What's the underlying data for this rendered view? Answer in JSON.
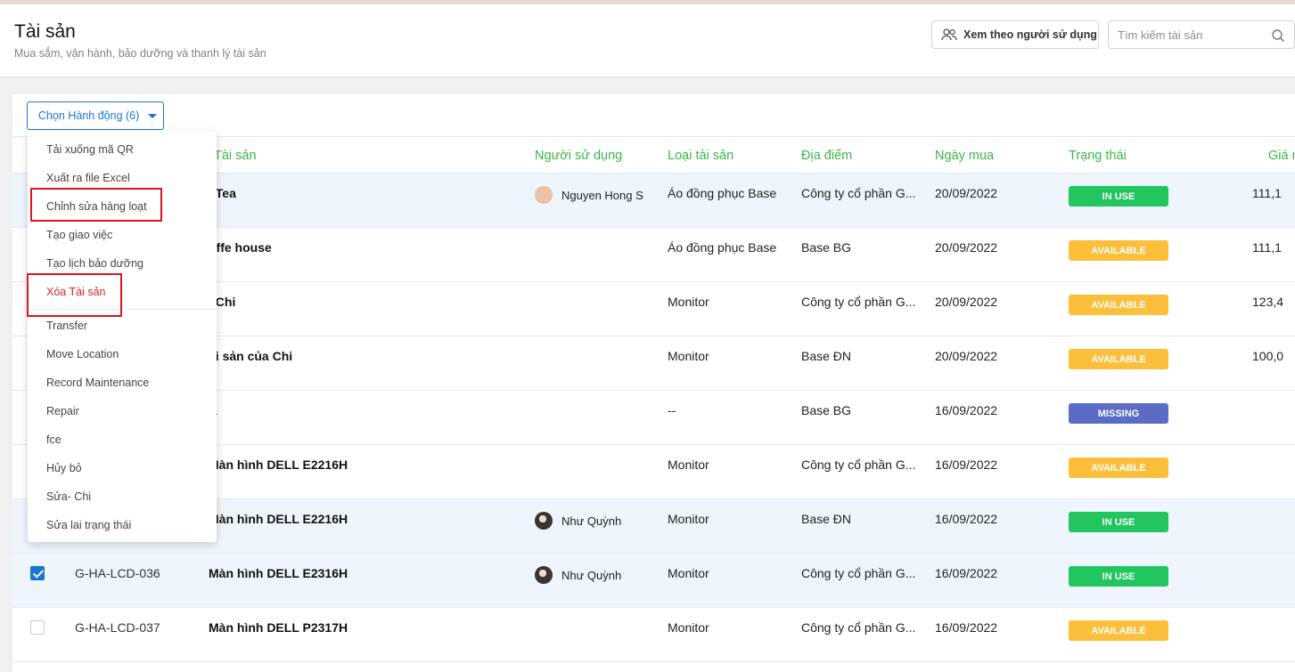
{
  "header": {
    "title": "Tài sản",
    "subtitle": "Mua sắm, vận hành, bảo dưỡng và thanh lý tài sản",
    "view_by_user_label": "Xem theo người sử dụng",
    "search_placeholder": "Tìm kiếm tài sản"
  },
  "toolbar": {
    "action_label": "Chọn Hành động (6)"
  },
  "table": {
    "columns": [
      "Tài sản",
      "Người sử dụng",
      "Loại tài sản",
      "Địa điểm",
      "Ngày mua",
      "Trạng thái",
      "Giá m"
    ],
    "rows": [
      {
        "code": "",
        "name": "i Tea",
        "user": "Nguyen Hong S",
        "avatar": "person",
        "type": "Áo đồng phục Base",
        "location": "Công ty cổ phần G...",
        "date": "20/09/2022",
        "status": "IN USE",
        "price": "111,1",
        "selected": true
      },
      {
        "code": "",
        "name": "offe house",
        "user": "",
        "avatar": "",
        "type": "Áo đồng phục Base",
        "location": "Base BG",
        "date": "20/09/2022",
        "status": "AVAILABLE",
        "price": "111,1",
        "selected": false
      },
      {
        "code": "",
        "name": "i Chi",
        "user": "",
        "avatar": "",
        "type": "Monitor",
        "location": "Công ty cổ phần G...",
        "date": "20/09/2022",
        "status": "AVAILABLE",
        "price": "123,4",
        "selected": false
      },
      {
        "code": "",
        "name": "ài sản của Chi",
        "user": "",
        "avatar": "",
        "type": "Monitor",
        "location": "Base ĐN",
        "date": "20/09/2022",
        "status": "AVAILABLE",
        "price": "100,0",
        "selected": false
      },
      {
        "code": "",
        "name": "A",
        "user": "",
        "avatar": "",
        "type": "--",
        "location": "Base BG",
        "date": "16/09/2022",
        "status": "MISSING",
        "price": "",
        "selected": false
      },
      {
        "code": "",
        "name": "Màn hình DELL E2216H",
        "user": "",
        "avatar": "",
        "type": "Monitor",
        "location": "Công ty cổ phần G...",
        "date": "16/09/2022",
        "status": "AVAILABLE",
        "price": "",
        "selected": false
      },
      {
        "code": "",
        "name": "Màn hình DELL E2216H",
        "user": "Như Quỳnh",
        "avatar": "photo",
        "type": "Monitor",
        "location": "Base ĐN",
        "date": "16/09/2022",
        "status": "IN USE",
        "price": "",
        "selected": true
      },
      {
        "code": "G-HA-LCD-036",
        "name": "Màn hình DELL E2316H",
        "user": "Như Quỳnh",
        "avatar": "photo",
        "type": "Monitor",
        "location": "Công ty cổ phần G...",
        "date": "16/09/2022",
        "status": "IN USE",
        "price": "",
        "selected": true,
        "checkbox": "checked"
      },
      {
        "code": "G-HA-LCD-037",
        "name": "Màn hình DELL P2317H",
        "user": "",
        "avatar": "",
        "type": "Monitor",
        "location": "Công ty cổ phần G...",
        "date": "16/09/2022",
        "status": "AVAILABLE",
        "price": "",
        "selected": false,
        "checkbox": "unchecked"
      }
    ]
  },
  "status_colors": {
    "IN USE": "#22c55e",
    "AVAILABLE": "#fbbf3c",
    "MISSING": "#5b6bc6"
  },
  "dropdown": {
    "items": [
      {
        "label": "Tải xuống mã QR",
        "style": "normal"
      },
      {
        "label": "Xuất ra file Excel",
        "style": "normal"
      },
      {
        "label": "Chỉnh sửa hàng loạt",
        "style": "normal",
        "highlighted": true
      },
      {
        "label": "Tạo giao việc",
        "style": "normal"
      },
      {
        "label": "Tạo lịch bảo dưỡng",
        "style": "normal"
      },
      {
        "label": "Xóa Tài sản",
        "style": "danger",
        "highlighted": true
      },
      {
        "label": "Transfer",
        "style": "normal"
      },
      {
        "label": "Move Location",
        "style": "normal"
      },
      {
        "label": "Record Maintenance",
        "style": "normal"
      },
      {
        "label": "Repair",
        "style": "normal"
      },
      {
        "label": "fce",
        "style": "normal"
      },
      {
        "label": "Hủy bỏ",
        "style": "normal"
      },
      {
        "label": "Sửa- Chi",
        "style": "normal"
      },
      {
        "label": "Sửa lai trạng thái",
        "style": "normal"
      }
    ]
  }
}
